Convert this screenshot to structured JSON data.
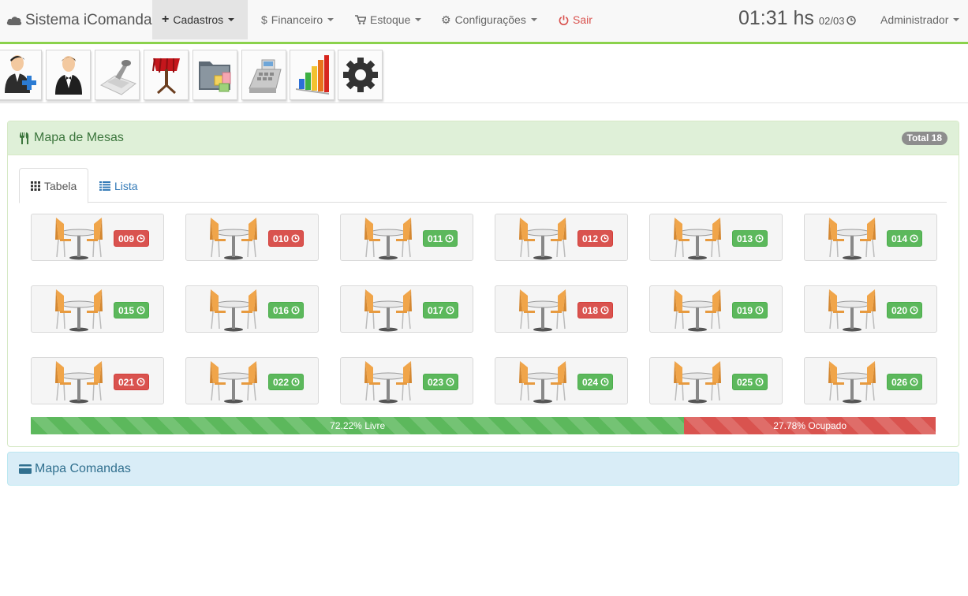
{
  "navbar": {
    "brand": "Sistema iComanda",
    "items": [
      {
        "label": "Cadastros",
        "icon": "plus-icon"
      },
      {
        "label": "Financeiro",
        "icon": "dollar-icon"
      },
      {
        "label": "Estoque",
        "icon": "cart-icon"
      },
      {
        "label": "Configurações",
        "icon": "gear-icon"
      },
      {
        "label": "Sair",
        "icon": "power-icon"
      }
    ],
    "time": "01:31 hs",
    "date": "02/03",
    "user": "Administrador"
  },
  "toolbar": [
    {
      "name": "add-client",
      "icon": "user-add-icon"
    },
    {
      "name": "waiter",
      "icon": "waiter-icon"
    },
    {
      "name": "stamp",
      "icon": "stamp-icon"
    },
    {
      "name": "table",
      "icon": "table-icon"
    },
    {
      "name": "products",
      "icon": "folder-icon"
    },
    {
      "name": "cash-register",
      "icon": "cash-register-icon"
    },
    {
      "name": "reports",
      "icon": "bar-chart-icon"
    },
    {
      "name": "settings",
      "icon": "settings-gear-icon"
    }
  ],
  "mesas_panel": {
    "title": "Mapa de Mesas",
    "total": "Total 18",
    "tabs": [
      "Tabela",
      "Lista"
    ],
    "mesas": [
      {
        "num": "009",
        "status": "ocupada"
      },
      {
        "num": "010",
        "status": "ocupada"
      },
      {
        "num": "011",
        "status": "livre"
      },
      {
        "num": "012",
        "status": "ocupada"
      },
      {
        "num": "013",
        "status": "livre"
      },
      {
        "num": "014",
        "status": "livre"
      },
      {
        "num": "015",
        "status": "livre"
      },
      {
        "num": "016",
        "status": "livre"
      },
      {
        "num": "017",
        "status": "livre"
      },
      {
        "num": "018",
        "status": "ocupada"
      },
      {
        "num": "019",
        "status": "livre"
      },
      {
        "num": "020",
        "status": "livre"
      },
      {
        "num": "021",
        "status": "ocupada"
      },
      {
        "num": "022",
        "status": "livre"
      },
      {
        "num": "023",
        "status": "livre"
      },
      {
        "num": "024",
        "status": "livre"
      },
      {
        "num": "025",
        "status": "livre"
      },
      {
        "num": "026",
        "status": "livre"
      }
    ],
    "progress": {
      "livre_pct": 72.22,
      "livre_label": "72.22% Livre",
      "ocupado_pct": 27.78,
      "ocupado_label": "27.78% Ocupado"
    }
  },
  "comandas_panel": {
    "title": "Mapa Comandas"
  },
  "colors": {
    "accent_green": "#8bd24c",
    "livre": "#5cb85c",
    "ocupada": "#d9534f"
  }
}
